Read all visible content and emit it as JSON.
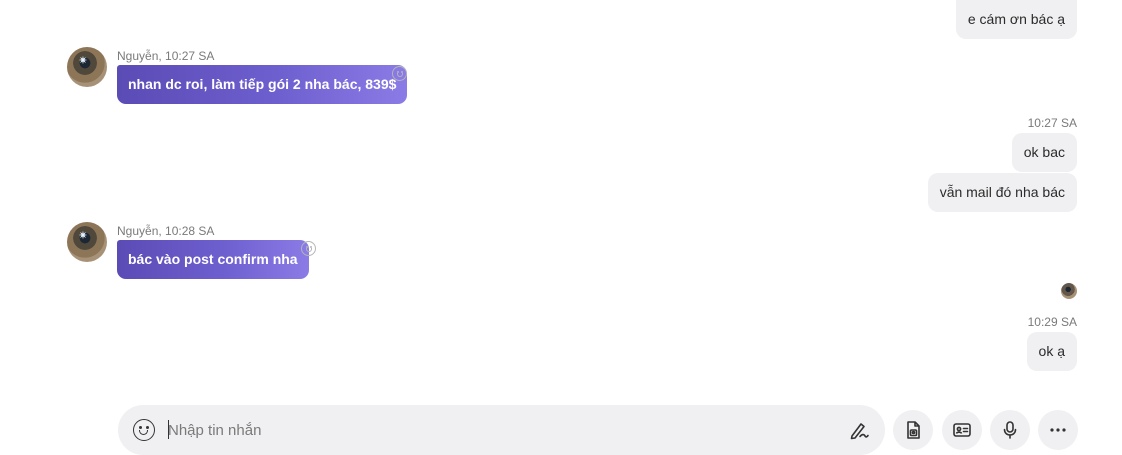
{
  "messages": {
    "out1": {
      "text": "e cám ơn bác ạ"
    },
    "in1": {
      "sender_meta": "Nguyễn, 10:27 SA",
      "text": "nhan dc roi, làm tiếp gói 2 nha bác, 839$"
    },
    "out2_time": "10:27 SA",
    "out2": {
      "text": "ok bac"
    },
    "out3": {
      "text": "vẫn mail đó nha bác"
    },
    "in2": {
      "sender_meta": "Nguyễn, 10:28 SA",
      "text": "bác vào post confirm nha"
    },
    "out4_time": "10:29 SA",
    "out4": {
      "text": "ok ạ"
    }
  },
  "composer": {
    "placeholder": "Nhập tin nhắn",
    "value": ""
  },
  "icons": {
    "emoji": "smiley-icon",
    "react": "add-reaction-icon",
    "format": "text-format-pen-icon",
    "file": "file-image-icon",
    "contact": "contact-card-icon",
    "mic": "microphone-icon",
    "more": "more-options-icon"
  },
  "colors": {
    "incoming_bubble_start": "#5a4bb5",
    "incoming_bubble_end": "#8a7be6",
    "outgoing_bubble": "#f0f0f2",
    "composer_bg": "#f0f0f2"
  }
}
